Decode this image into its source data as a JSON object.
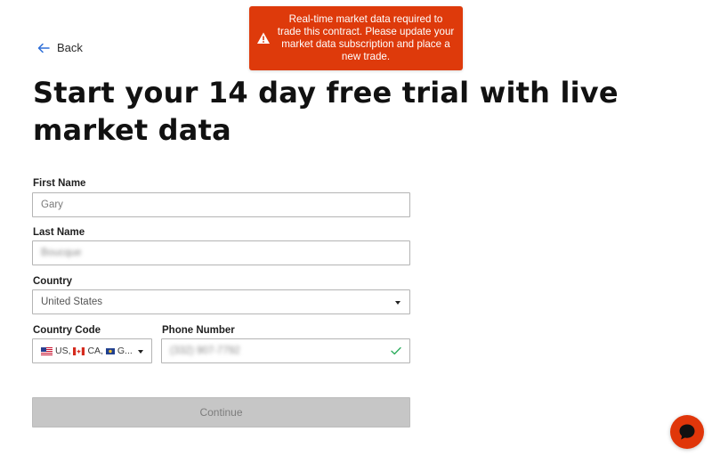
{
  "nav": {
    "back_label": "Back"
  },
  "toast": {
    "message": "Real-time market data required to trade this contract. Please update your market data subscription and place a new trade.",
    "icon": "warning-icon",
    "color": "#de3a0b"
  },
  "page": {
    "title": "Start your 14 day free trial with live market data"
  },
  "form": {
    "first_name": {
      "label": "First Name",
      "value": "Gary"
    },
    "last_name": {
      "label": "Last Name",
      "value": "Boucque"
    },
    "country": {
      "label": "Country",
      "value": "United States"
    },
    "country_code": {
      "label": "Country Code",
      "value": "US, CA, G...",
      "parts": [
        "US,",
        "CA,",
        "G..."
      ]
    },
    "phone": {
      "label": "Phone Number",
      "value": "(332) 907-7792"
    },
    "continue_label": "Continue"
  },
  "chat": {
    "icon": "chat-bubble-icon",
    "color": "#e0360a"
  }
}
